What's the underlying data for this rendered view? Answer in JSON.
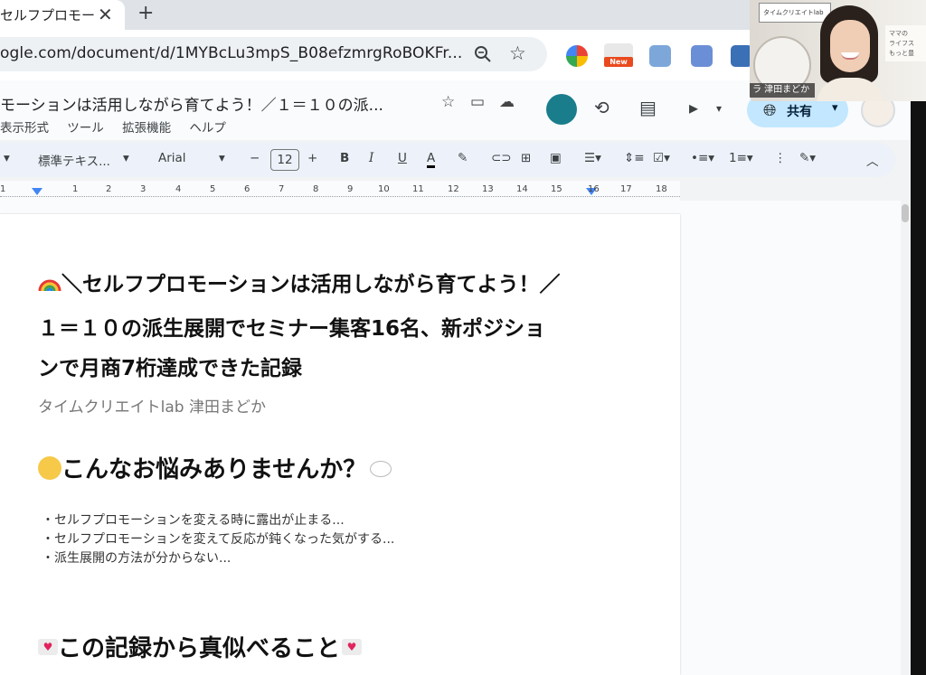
{
  "browser": {
    "tab_title": "セルフプロモー",
    "tab_close": "✕",
    "new_tab": "+",
    "url": "ogle.com/document/d/1MYBcLu3mpS_B08efzmrgRoBOKFr...",
    "ext_new_badge": "New"
  },
  "docs_header": {
    "title": "モーションは活用しながら育てよう！／１＝１０の派...",
    "menu_items": [
      "表示形式",
      "ツール",
      "拡張機能",
      "ヘルプ"
    ],
    "share_label": "共有"
  },
  "toolbar": {
    "style": "標準テキス...",
    "font": "Arial",
    "font_size": "12",
    "bold": "B",
    "italic": "I",
    "underline": "U",
    "text_color": "A"
  },
  "ruler": {
    "ticks": [
      "1",
      "1",
      "2",
      "3",
      "4",
      "5",
      "6",
      "7",
      "8",
      "9",
      "10",
      "11",
      "12",
      "13",
      "14",
      "15",
      "16",
      "17",
      "18"
    ]
  },
  "document": {
    "title_line1": "＼セルフプロモーションは活用しながら育てよう！／",
    "title_line2": "１＝１０の派生展開でセミナー集客16名、新ポジショ",
    "title_line3": "ンで月商7桁達成できた記録",
    "author": "タイムクリエイトlab 津田まどか",
    "heading1": "こんなお悩みありませんか？",
    "bullets": [
      "・セルフプロモーションを変える時に露出が止まる...",
      "・セルフプロモーションを変えて反応が鈍くなった気がする...",
      "・派生展開の方法が分からない..."
    ],
    "heading2": "この記録から真似べること"
  },
  "video": {
    "logo_text": "タイムクリエイトlab",
    "name_tag": "ラ 津田まどか",
    "sign_lines": [
      "ママの",
      "ライフス",
      "もっと豊"
    ]
  },
  "colors": {
    "share_bg": "#c2e7ff",
    "toolbar_bg": "#edf2fa",
    "ruler_marker": "#4285f4"
  }
}
